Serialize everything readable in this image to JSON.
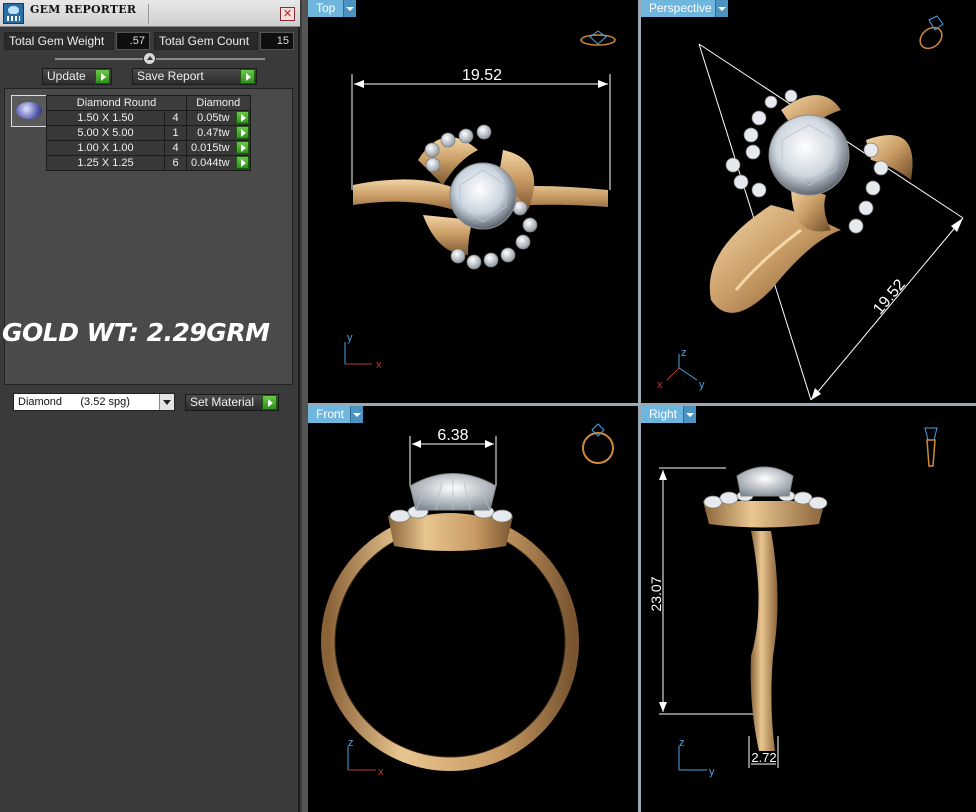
{
  "panel": {
    "title": "GEM REPORTER",
    "close_label": "✕",
    "total_gem_weight_label": "Total Gem Weight",
    "total_gem_weight_value": ".57",
    "total_gem_count_label": "Total Gem Count",
    "total_gem_count_value": "15",
    "update_label": "Update",
    "save_report_label": "Save Report",
    "gem_table": {
      "headers": [
        "Diamond Round",
        "Diamond"
      ],
      "rows": [
        {
          "size": "1.50 X 1.50",
          "count": "4",
          "weight": "0.05tw"
        },
        {
          "size": "5.00 X 5.00",
          "count": "1",
          "weight": "0.47tw"
        },
        {
          "size": "1.00 X 1.00",
          "count": "4",
          "weight": "0.015tw"
        },
        {
          "size": "1.25 X 1.25",
          "count": "6",
          "weight": "0.044tw"
        }
      ]
    },
    "gold_weight_text": "GOLD WT: 2.29GRM",
    "material_select": "Diamond      (3.52 spg)",
    "set_material_label": "Set Material"
  },
  "viewports": {
    "top": {
      "label": "Top",
      "dimension": "19.52",
      "axis_a": "y",
      "axis_b": "x"
    },
    "perspective": {
      "label": "Perspective",
      "dimension": "19.52",
      "axis_z": "z",
      "axis_x": "x",
      "axis_y": "y"
    },
    "front": {
      "label": "Front",
      "dimension": "6.38",
      "axis_a": "z",
      "axis_b": "x"
    },
    "right": {
      "label": "Right",
      "dimension_height": "23.07",
      "dimension_width": "2.72",
      "axis_a": "z",
      "axis_b": "y"
    }
  },
  "colors": {
    "gold": "#c79a63",
    "viewport_tab": "#6fb6de",
    "dimension_line": "#ffffff",
    "axis_red": "#c0392b",
    "axis_blue": "#4aa3df"
  }
}
